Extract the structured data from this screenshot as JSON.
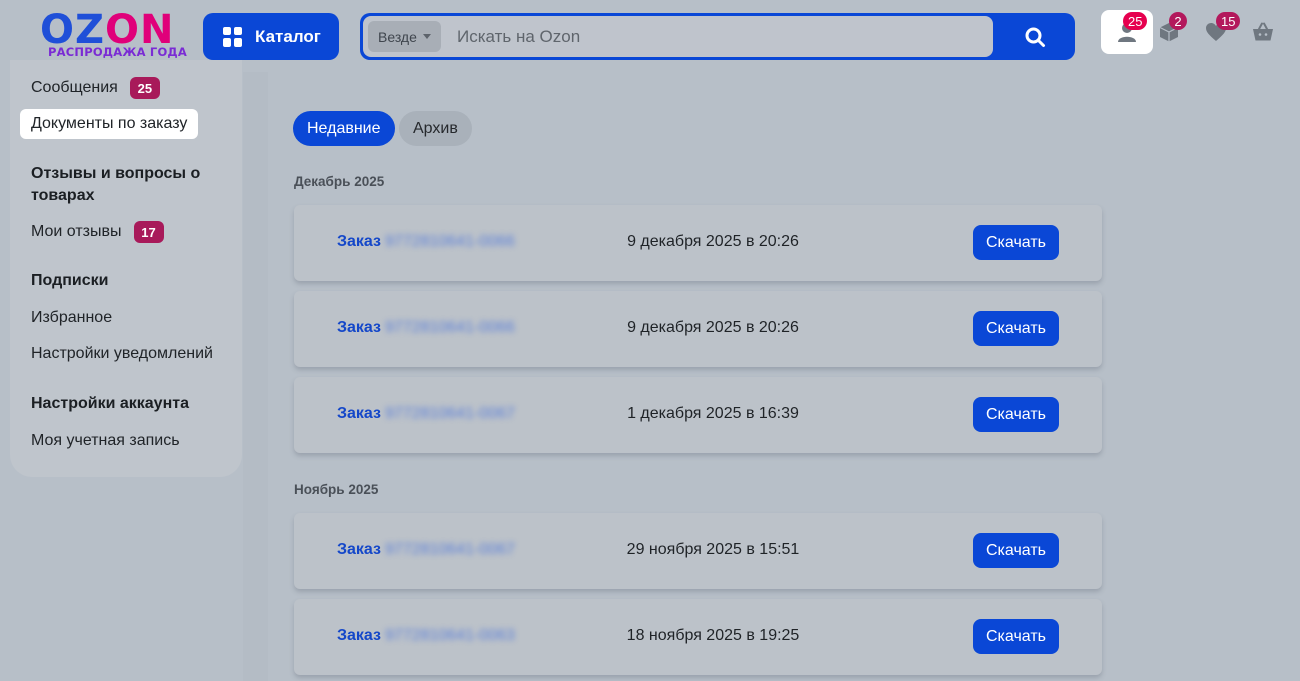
{
  "header": {
    "logo_text_main": "OZ",
    "logo_text_accent": "ON",
    "logo_tagline": "РАСПРОДАЖА ГОДА",
    "catalog_label": "Каталог",
    "search_scope": "Везде",
    "search_placeholder": "Искать на Ozon",
    "icons": [
      {
        "name": "profile-icon",
        "badge": "25"
      },
      {
        "name": "orders-icon",
        "badge": "2"
      },
      {
        "name": "favorites-icon",
        "badge": "15"
      },
      {
        "name": "cart-icon",
        "badge": ""
      }
    ]
  },
  "sidebar": {
    "messages": {
      "label": "Сообщения",
      "badge": "25"
    },
    "documents": {
      "label": "Документы по заказу"
    },
    "reviews_heading": "Отзывы и вопросы о товарах",
    "my_reviews": {
      "label": "Мои отзывы",
      "badge": "17"
    },
    "subscriptions_heading": "Подписки",
    "favorites": {
      "label": "Избранное"
    },
    "notifications": {
      "label": "Настройки уведомлений"
    },
    "account_heading": "Настройки аккаунта",
    "my_account": {
      "label": "Моя учетная запись"
    }
  },
  "main": {
    "tabs": [
      {
        "label": "Недавние",
        "active": true
      },
      {
        "label": "Архив",
        "active": false
      }
    ],
    "groups": [
      {
        "title": "Декабрь 2025",
        "orders": [
          {
            "prefix": "Заказ",
            "number": "9772810641-0066",
            "date": "9 декабря 2025 в 20:26",
            "action": "Скачать"
          },
          {
            "prefix": "Заказ",
            "number": "9772810641-0066",
            "date": "9 декабря 2025 в 20:26",
            "action": "Скачать"
          },
          {
            "prefix": "Заказ",
            "number": "9772810641-0067",
            "date": "1 декабря 2025 в 16:39",
            "action": "Скачать"
          }
        ]
      },
      {
        "title": "Ноябрь 2025",
        "orders": [
          {
            "prefix": "Заказ",
            "number": "9772810641-0067",
            "date": "29 ноября 2025 в 15:51",
            "action": "Скачать"
          },
          {
            "prefix": "Заказ",
            "number": "9772810641-0063",
            "date": "18 ноября 2025 в 19:25",
            "action": "Скачать"
          }
        ]
      }
    ]
  },
  "colors": {
    "brand_blue": "#0a47d6",
    "badge_pink": "#e6004f",
    "link_blue": "#1447c9"
  }
}
